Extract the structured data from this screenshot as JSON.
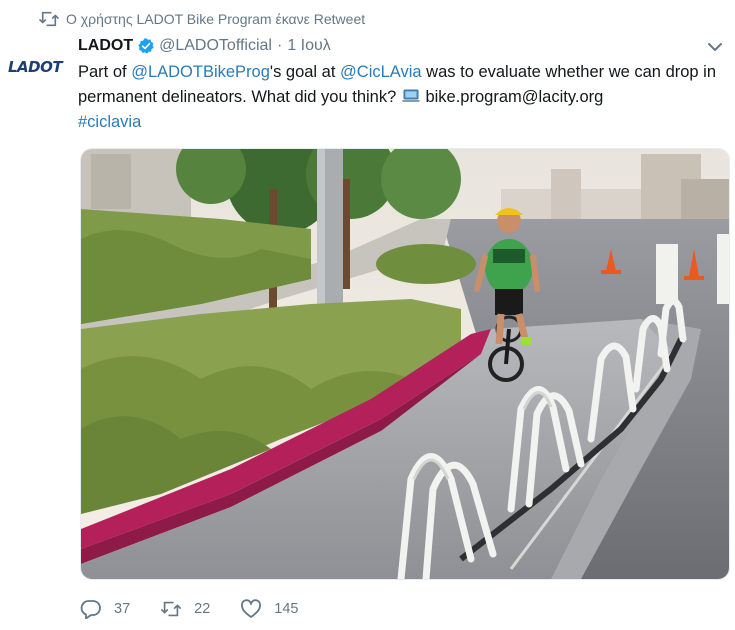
{
  "retweet_notice": {
    "text": "Ο χρήστης LADOT Bike Program έκανε Retweet",
    "icon": "retweet-icon"
  },
  "author": {
    "logo_text": "LADOT",
    "name": "LADOT",
    "verified_icon": "verified-badge-icon",
    "handle": "@LADOTofficial",
    "separator": "·",
    "date": "1 Ιουλ"
  },
  "menu_icon": "chevron-down-icon",
  "tweet": {
    "t1": "Part of ",
    "mention1": "@LADOTBikeProg",
    "t2": "'s  goal at ",
    "mention2": "@CicLAvia",
    "t3": " was to evaluate whether we can drop in permanent delineators. What did you think? ",
    "t4": " bike.program@lacity.org",
    "hashtag": "#ciclavia",
    "emoji_icon": "laptop-icon"
  },
  "media": {
    "description_icon": "photo"
  },
  "actions": {
    "reply": {
      "icon": "reply-icon",
      "count": "37"
    },
    "retweet": {
      "icon": "retweet-icon",
      "count": "22"
    },
    "like": {
      "icon": "heart-icon",
      "count": "145"
    }
  },
  "colors": {
    "link": "#2b7bb9",
    "secondary_text": "#657786",
    "verified": "#1da1f2",
    "curb": "#b3205a"
  }
}
